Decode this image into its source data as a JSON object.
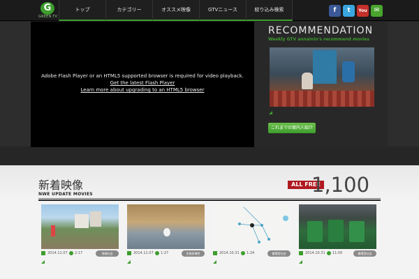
{
  "header": {
    "logo_text": "G",
    "logo_word": "GREEN.TV",
    "nav": [
      "トップ",
      "カテゴリー",
      "オススメ映像",
      "GTVニュース",
      "絞り込み検索"
    ],
    "social": [
      {
        "icon": "facebook-icon",
        "glyph": "f",
        "color": "#3b5998"
      },
      {
        "icon": "twitter-icon",
        "glyph": "t",
        "color": "#3aa7e0"
      },
      {
        "icon": "youtube-icon",
        "glyph": "You",
        "color": "#c4302b"
      },
      {
        "icon": "mail-icon",
        "glyph": "✉",
        "color": "#4aa52e",
        "label": "メルマガ"
      }
    ]
  },
  "player": {
    "message": "Adobe Flash Player or an HTML5 supported browser is required for video playback.",
    "link1": "Get the latest Flash Player",
    "link2": "Learn more about upgrading to an HTML5 browser"
  },
  "recommendation": {
    "title": "RECOMMENDATION",
    "subtitle": "Weekly GTV annainin's recommend movies",
    "button": "これまでの案内人紹介"
  },
  "new_videos": {
    "title": "新着映像",
    "subtitle": "NWE UPDATE MOVIES",
    "badge": "ALL FREE",
    "count": "1,100",
    "cards": [
      {
        "date": "2014.11.07",
        "duration": "2:17",
        "tag": "地域社会"
      },
      {
        "date": "2014.11.07",
        "duration": "1:27",
        "tag": "生物多様性"
      },
      {
        "date": "2014.10.31",
        "duration": "1:24",
        "tag": "循環型社会"
      },
      {
        "date": "2014.10.31",
        "duration": "11:00",
        "tag": "循環型社会"
      }
    ]
  },
  "colors": {
    "accent": "#3d9d2d",
    "badge": "#b01920"
  }
}
